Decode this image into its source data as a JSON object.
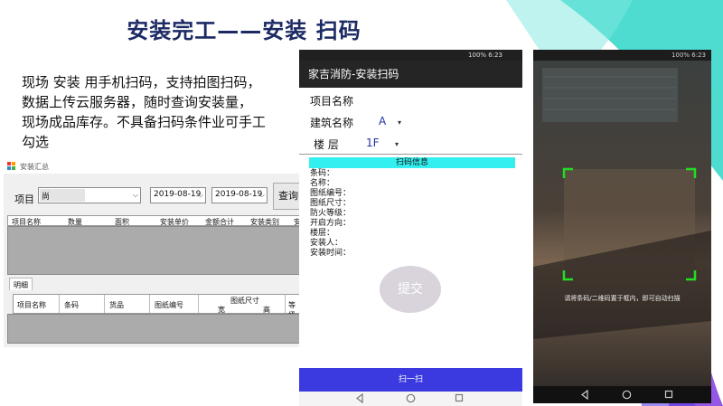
{
  "slide": {
    "title": "安装完工——安装 扫码",
    "description": [
      "现场 安装 用手机扫码，支持拍图扫码，",
      "数据上传云服务器，随时查询安装量，",
      "现场成品库存。不具备扫码条件业可手工",
      "勾选"
    ]
  },
  "desktop": {
    "window_title": "安装汇总",
    "project_label": "项目",
    "project_value": "尚",
    "date_from": "2019-08-19",
    "date_to": "2019-08-19",
    "query_label": "查询",
    "summary_columns": [
      "项目名称",
      "数量",
      "面积",
      "安装单价",
      "金额合计",
      "安装类别",
      "安"
    ],
    "detail_tab": "明细",
    "detail_columns": [
      "项目名称",
      "条码",
      "货品",
      "图纸编号"
    ],
    "drawing_size_label": "图纸尺寸",
    "drawing_size_sub": [
      "宽",
      "高"
    ],
    "detail_more": "等级"
  },
  "phone_form": {
    "status": "100% 6:23",
    "app_title": "家吉消防-安装扫码",
    "project_name_label": "项目名称",
    "building_label": "建筑名称",
    "building_value": "A",
    "floor_label": "楼 层",
    "floor_value": "1F",
    "scan_info_header": "扫码信息",
    "scan_fields": [
      "条码：",
      "名称：",
      "图纸编号：",
      "图纸尺寸：",
      "防火等级：",
      "开启方向：",
      "楼层：",
      "安装人：",
      "安装时间："
    ],
    "submit_label": "提交",
    "scan_button": "扫一扫"
  },
  "phone_scanner": {
    "status": "100% 6:23",
    "hint": "请将条码/二维码置于框内，即可自动扫描"
  },
  "colors": {
    "title": "#1c2a64",
    "scan_header": "#33f0f0",
    "scan_button": "#3a3ae0",
    "viewfinder": "#22dd22"
  }
}
